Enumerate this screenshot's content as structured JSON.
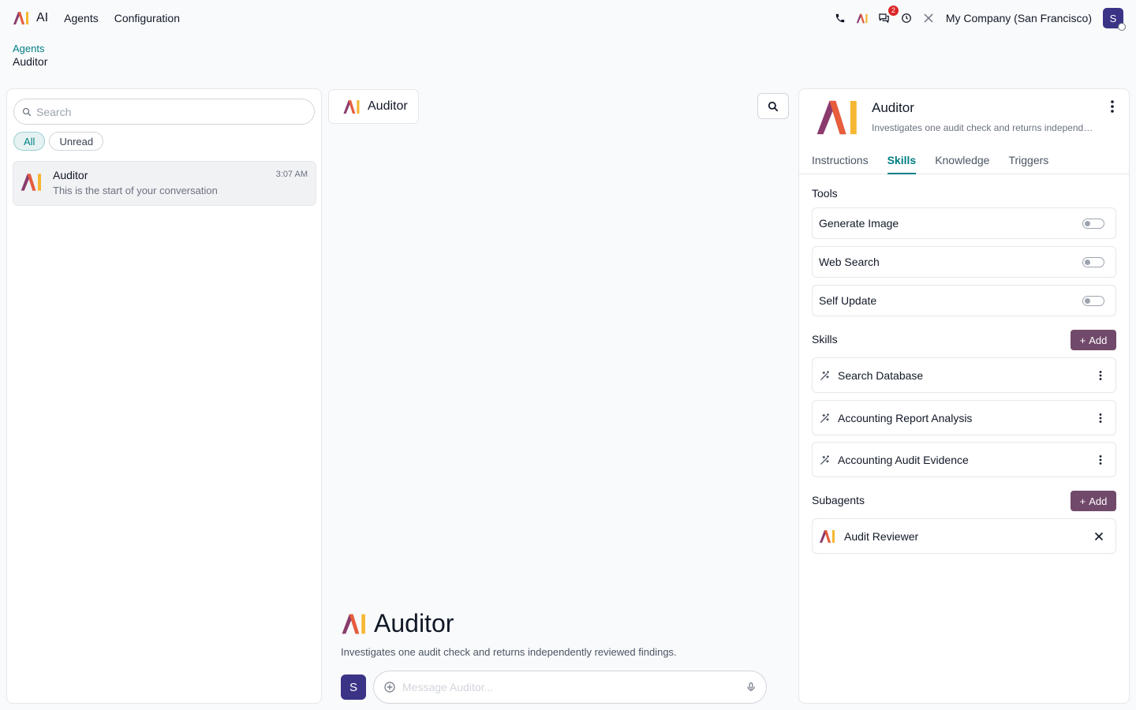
{
  "navbar": {
    "brand": "AI",
    "menu": [
      "Agents",
      "Configuration"
    ],
    "notification_count": "2",
    "company": "My Company (San Francisco)",
    "user_initial": "S"
  },
  "breadcrumb": {
    "parent": "Agents",
    "current": "Auditor"
  },
  "sidebar": {
    "search_placeholder": "Search",
    "filters": [
      "All",
      "Unread"
    ],
    "conversations": [
      {
        "name": "Auditor",
        "preview": "This is the start of your conversation",
        "time": "3:07 AM"
      }
    ]
  },
  "chat": {
    "title": "Auditor",
    "welcome_title": "Auditor",
    "welcome_desc": "Investigates one audit check and returns independently reviewed findings.",
    "composer_placeholder": "Message Auditor...",
    "user_initial": "S"
  },
  "agent": {
    "name": "Auditor",
    "description": "Investigates one audit check and returns independently reviewed findings.",
    "tabs": [
      "Instructions",
      "Skills",
      "Knowledge",
      "Triggers"
    ],
    "active_tab": "Skills",
    "tools_title": "Tools",
    "tools": [
      {
        "label": "Generate Image",
        "enabled": false
      },
      {
        "label": "Web Search",
        "enabled": false
      },
      {
        "label": "Self Update",
        "enabled": false
      }
    ],
    "skills_title": "Skills",
    "skills": [
      "Search Database",
      "Accounting Report Analysis",
      "Accounting Audit Evidence"
    ],
    "subagents_title": "Subagents",
    "subagents": [
      "Audit Reviewer"
    ],
    "add_label": "Add"
  },
  "colors": {
    "accent": "#017e84",
    "primary": "#71496a",
    "avatar": "#3b3486",
    "badge": "#dc2626"
  }
}
